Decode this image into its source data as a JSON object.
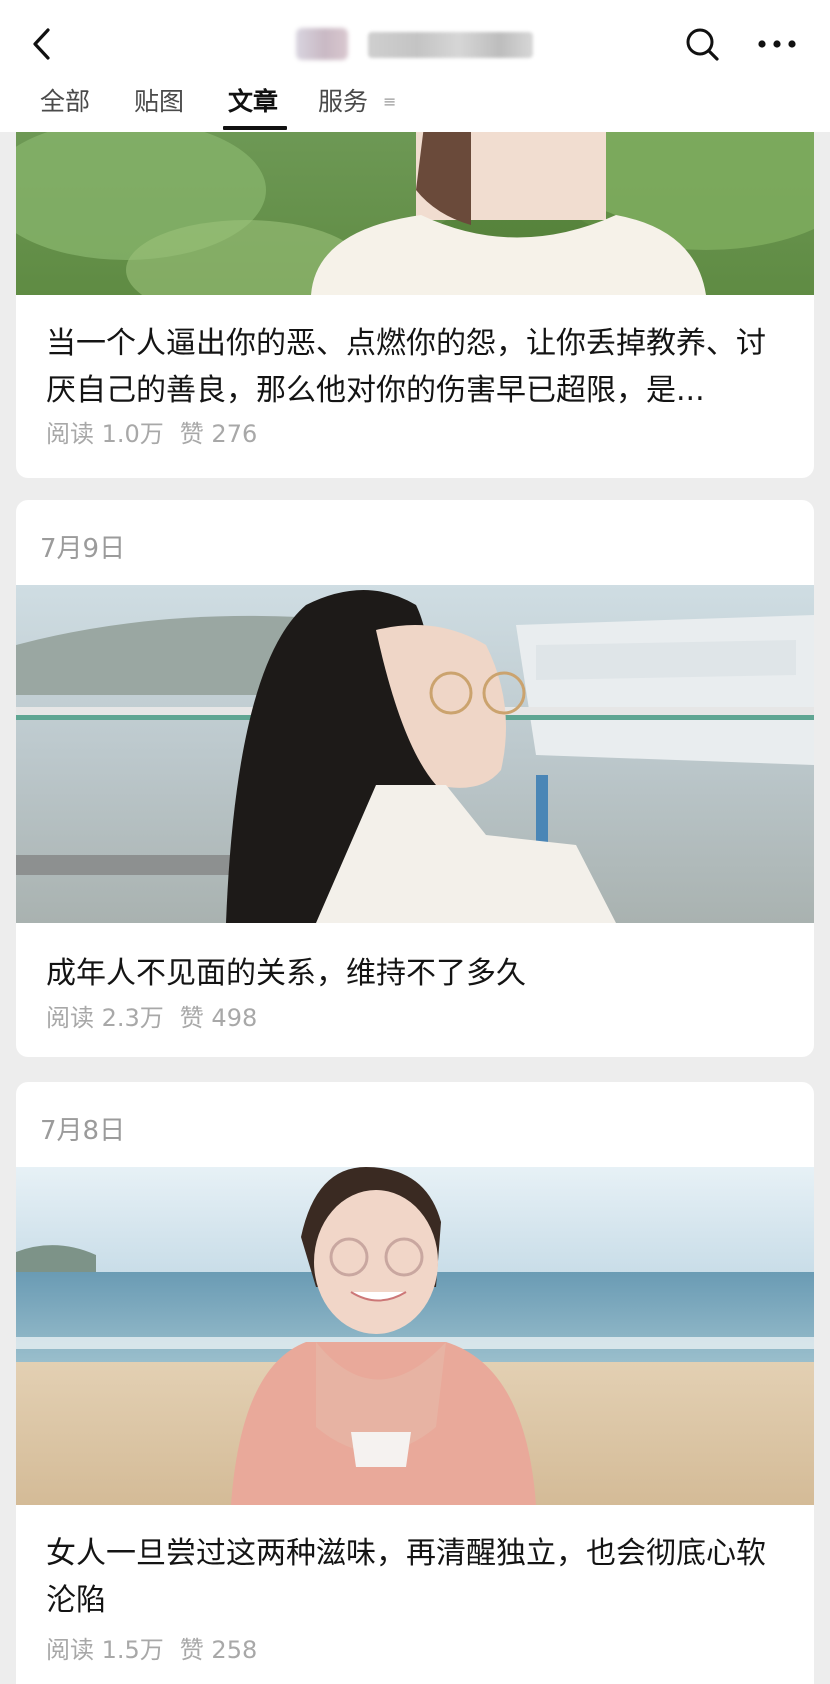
{
  "header": {
    "icons": {
      "back": "chevron-left-icon",
      "search": "search-icon",
      "more": "more-dots-icon",
      "tab_menu": "menu-lines-icon"
    },
    "tabs": [
      {
        "label": "全部"
      },
      {
        "label": "贴图"
      },
      {
        "label": "文章"
      },
      {
        "label": "服务"
      }
    ],
    "active_tab": "文章",
    "tab_menu_glyph": "≡"
  },
  "articles": [
    {
      "title": "当一个人逼出你的恶、点燃你的怨，让你丢掉教养、讨厌自己的善良，那么他对你的伤害早已超限，是...",
      "reads": "阅读 1.0万",
      "likes": "赞 276"
    },
    {
      "date": "7月9日",
      "title": "成年人不见面的关系，维持不了多久",
      "reads": "阅读 2.3万",
      "likes": "赞 498"
    },
    {
      "date": "7月8日",
      "title": "女人一旦尝过这两种滋味，再清醒独立，也会彻底心软沦陷",
      "reads": "阅读 1.5万",
      "likes": "赞 258"
    }
  ],
  "colors": {
    "background": "#ededed",
    "card": "#ffffff",
    "meta": "#a8a8a8",
    "date": "#9b9b9b"
  }
}
